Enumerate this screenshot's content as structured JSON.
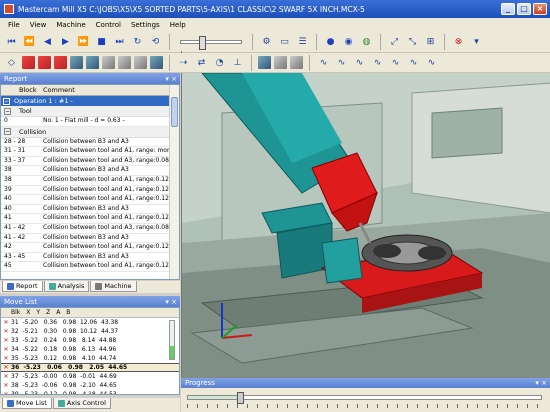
{
  "window": {
    "title": "Mastercam Mill X5  C:\\JOBS\\X5\\X5 SORTED PARTS\\5-AXIS\\1 CLASSIC\\2 SWARF 5X INCH.MCX-5"
  },
  "menu": [
    "File",
    "View",
    "Machine",
    "Control",
    "Settings",
    "Help"
  ],
  "report": {
    "title": "Report",
    "columns": [
      "Block",
      "Comment"
    ],
    "operation": "Operation 1 : #1 -",
    "tool_group": "Tool",
    "tool_row": {
      "block": "0",
      "comment": "No. 1 - Flat mill - d = 0.63 -"
    },
    "collision_group": "Collision",
    "rows": [
      {
        "block": "28 - 28",
        "comment": "Collision between B3 and A3"
      },
      {
        "block": "31 - 31",
        "comment": "Collision between tool and A1, range: more th"
      },
      {
        "block": "33 - 37",
        "comment": "Collision between tool and A3, range:0.08333"
      },
      {
        "block": "38",
        "comment": "Collision between B3 and A3"
      },
      {
        "block": "38",
        "comment": "Collision between tool and A1, range:0.12499"
      },
      {
        "block": "39",
        "comment": "Collision between tool and A1, range:0.12499"
      },
      {
        "block": "40",
        "comment": "Collision between tool and A1, range:0.12499"
      },
      {
        "block": "40",
        "comment": "Collision between B3 and A3"
      },
      {
        "block": "41",
        "comment": "Collision between tool and A1, range:0.12499"
      },
      {
        "block": "41 - 42",
        "comment": "Collision between tool and A3, range:0.08333"
      },
      {
        "block": "41 - 42",
        "comment": "Collision between B3 and A3"
      },
      {
        "block": "42",
        "comment": "Collision between tool and A1, range:0.12499"
      },
      {
        "block": "43 - 45",
        "comment": "Collision between B3 and A3"
      },
      {
        "block": "45",
        "comment": "Collision between tool and A1, range:0.12499"
      }
    ]
  },
  "report_tabs": [
    "Report",
    "Analysis",
    "Machine"
  ],
  "movelist": {
    "title": "Move List",
    "columns": [
      "Blk",
      "X",
      "Y",
      "Z",
      "A",
      "B"
    ],
    "rows": [
      {
        "text": "31  -5.20   0.36   0.98  12.06  43.38",
        "current": false
      },
      {
        "text": "32  -5.21   0.30   0.98  10.12  44.37",
        "current": false
      },
      {
        "text": "33  -5.22   0.24   0.98   8.14  44.88",
        "current": false
      },
      {
        "text": "34  -5.22   0.18   0.98   6.13  44.96",
        "current": false
      },
      {
        "text": "35  -5.23   0.12   0.98   4.10  44.74",
        "current": false
      },
      {
        "text": "36  -5.23   0.06   0.98   2.05  44.65",
        "current": true
      },
      {
        "text": "37  -5.23  -0.00   0.98  -0.01  44.69",
        "current": false
      },
      {
        "text": "38  -5.23  -0.06   0.98  -2.10  44.65",
        "current": false
      },
      {
        "text": "39  -5.23  -0.12   0.98  -4.18  44.53",
        "current": false
      },
      {
        "text": "40  -5.23  -0.18   0.98  -6.28  44.31",
        "current": false
      }
    ],
    "gauge_level": 0.35
  },
  "bottom_tabs": [
    "Move List",
    "Axis Control"
  ],
  "progress": {
    "title": "Progress",
    "value": 0.15
  },
  "colors": {
    "accent": "#316ac5",
    "title_bar": "#1d4fb8",
    "machine_teal": "#1f9494",
    "spindle_red": "#e01b1b"
  }
}
